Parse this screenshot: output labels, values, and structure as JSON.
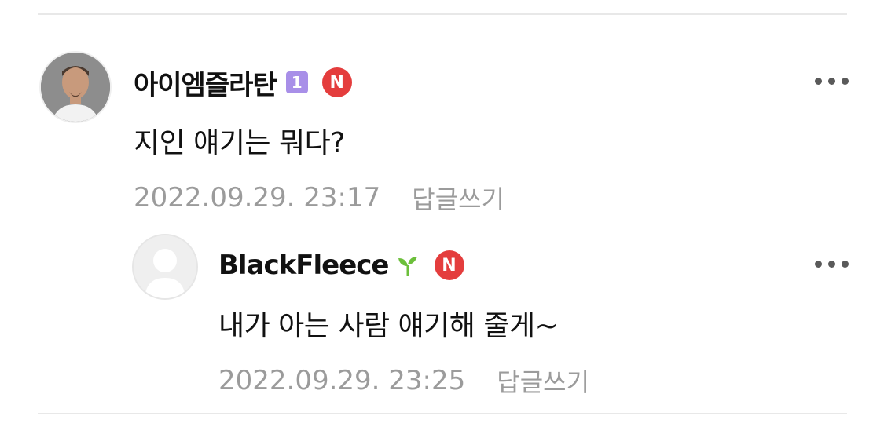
{
  "comments": [
    {
      "nickname": "아이엠즐라탄",
      "rank_badge": "1",
      "text": "지인 얘기는 뭐다?",
      "date": "2022.09.29. 23:17",
      "reply_label": "답글쓰기",
      "avatar_icon": "profile-photo",
      "more_icon": "more-options-icon"
    },
    {
      "nickname": "BlackFleece",
      "level_icon": "sprout-icon",
      "text": "내가 아는 사람 얘기해 줄게~",
      "date": "2022.09.29. 23:25",
      "reply_label": "답글쓰기",
      "avatar_icon": "default-avatar-icon",
      "more_icon": "more-options-icon"
    }
  ],
  "new_badge_label": "N",
  "colors": {
    "rank_badge": "#a88fe8",
    "new_badge": "#e43d3d",
    "sprout": "#6cbf3b",
    "meta_text": "#9b9b9b",
    "divider": "#e8e8e8"
  }
}
